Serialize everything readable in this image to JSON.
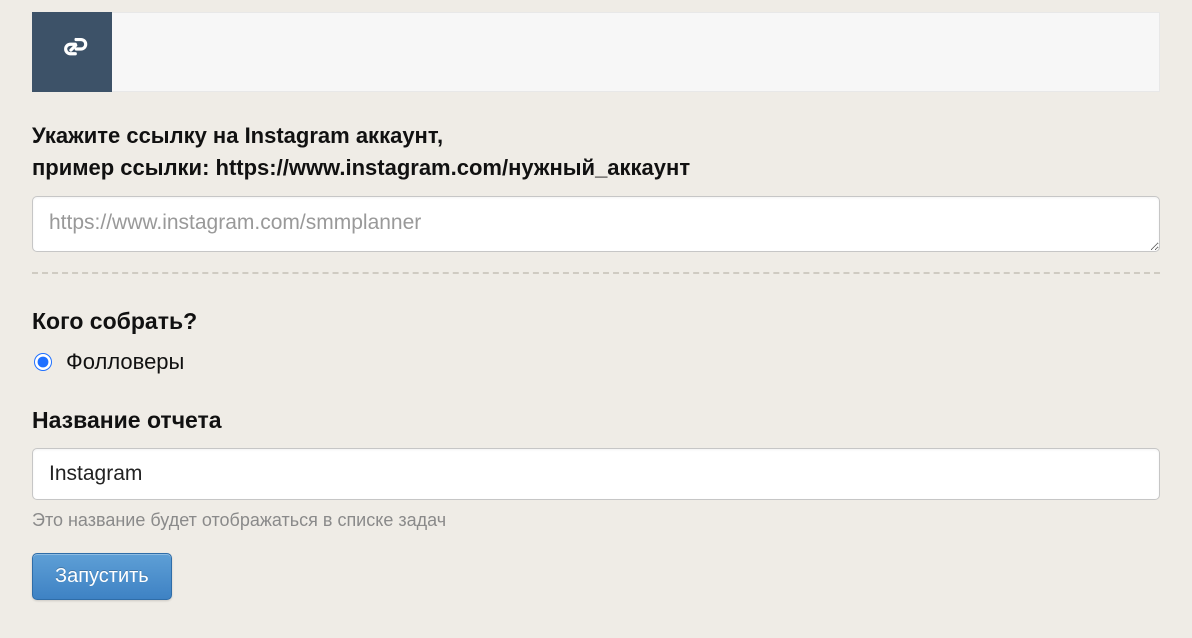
{
  "header": {
    "icon": "link-icon"
  },
  "form": {
    "url_label_line1": "Укажите ссылку на Instagram аккаунт,",
    "url_label_line2": "пример ссылки: https://www.instagram.com/нужный_аккаунт",
    "url_placeholder": "https://www.instagram.com/smmplanner",
    "url_value": "",
    "collect_heading": "Кого собрать?",
    "collect_options": [
      {
        "label": "Фолловеры",
        "checked": true
      }
    ],
    "report_heading": "Название отчета",
    "report_value": "Instagram",
    "report_help": "Это название будет отображаться в списке задач",
    "submit_label": "Запустить"
  }
}
